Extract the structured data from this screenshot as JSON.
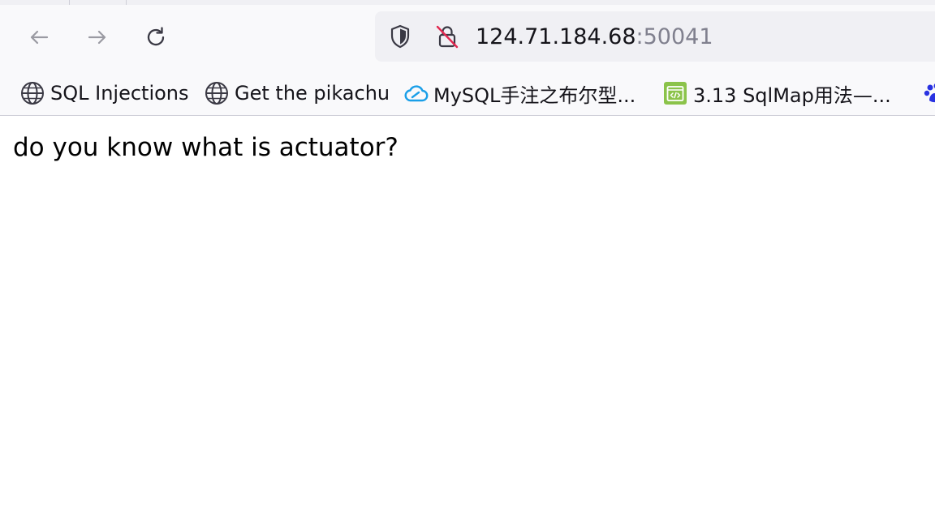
{
  "browser": {
    "url": {
      "host": "124.71.184.68",
      "port": ":50041"
    },
    "bookmarks": [
      {
        "label": "SQL Injections",
        "icon": "globe-icon"
      },
      {
        "label": "Get the pikachu",
        "icon": "globe-icon"
      },
      {
        "label": "MySQL手注之布尔型...",
        "icon": "cloud-icon"
      },
      {
        "label": "3.13 SqlMap用法—...",
        "icon": "code-window-icon"
      }
    ]
  },
  "page": {
    "text": "do you know what is actuator?"
  },
  "colors": {
    "toolbar_bg": "#f9f9fb",
    "urlbar_bg": "#f0f0f4",
    "insecure_accent": "#e22850",
    "cloud_icon": "#1a9fe8",
    "code_icon_bg": "#8bc34a"
  }
}
